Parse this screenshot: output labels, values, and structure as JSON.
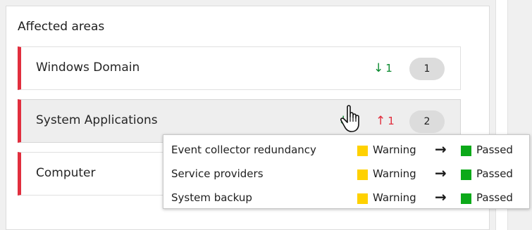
{
  "panel": {
    "title": "Affected areas"
  },
  "areas": [
    {
      "label": "Windows Domain",
      "trends": [
        {
          "direction": "down",
          "arrow": "↓",
          "value": "1"
        }
      ],
      "count": "1"
    },
    {
      "label": "System Applications",
      "trends": [
        {
          "direction": "down",
          "arrow": "↓",
          "value": ""
        },
        {
          "direction": "up",
          "arrow": "↑",
          "value": "1"
        }
      ],
      "count": "2"
    },
    {
      "label": "Computer",
      "trends": [],
      "count": ""
    }
  ],
  "tooltip": {
    "rows": [
      {
        "name": "Event collector redundancy",
        "from": "Warning",
        "arrow": "→",
        "to": "Passed"
      },
      {
        "name": "Service providers",
        "from": "Warning",
        "arrow": "→",
        "to": "Passed"
      },
      {
        "name": "System backup",
        "from": "Warning",
        "arrow": "→",
        "to": "Passed"
      }
    ]
  },
  "colors": {
    "alert_bar": "#e12e3e",
    "trend_down": "#0a8a2f",
    "trend_up": "#e12e3e",
    "warning": "#ffd100",
    "passed": "#0ca919"
  },
  "icons": {
    "cursor": "hand-pointer-icon",
    "down": "arrow-down-icon",
    "up": "arrow-up-icon",
    "transition": "arrow-right-icon"
  }
}
